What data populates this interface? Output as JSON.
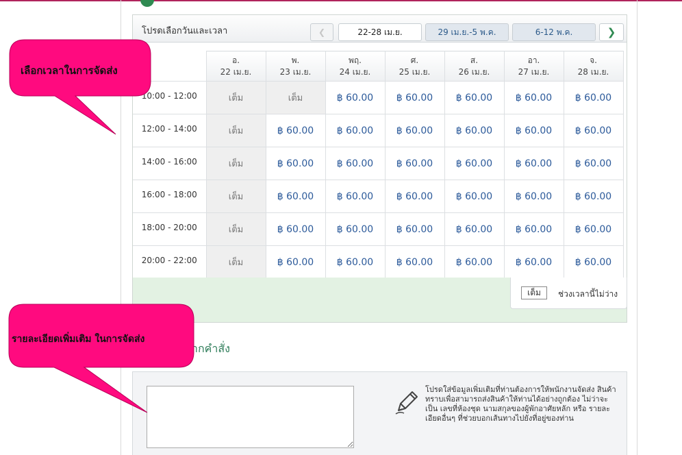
{
  "schedule": {
    "title": "โปรดเลือกวันและเวลา",
    "nav": {
      "prev_icon": "chevron-left-icon",
      "prev_glyph": "❮",
      "current_week": "22-28 เม.ย.",
      "week2": "29 เม.ย.-5 พ.ค.",
      "week3": "6-12 พ.ค.",
      "next_icon": "chevron-right-icon",
      "next_glyph": "❯"
    },
    "days": [
      {
        "day": "อ.",
        "date": "22 เม.ย."
      },
      {
        "day": "พ.",
        "date": "23 เม.ย."
      },
      {
        "day": "พฤ.",
        "date": "24 เม.ย."
      },
      {
        "day": "ศ.",
        "date": "25 เม.ย."
      },
      {
        "day": "ส.",
        "date": "26 เม.ย."
      },
      {
        "day": "อา.",
        "date": "27 เม.ย."
      },
      {
        "day": "จ.",
        "date": "28 เม.ย."
      }
    ],
    "rows": [
      {
        "time": "10:00 - 12:00",
        "cells": [
          "เต็ม",
          "เต็ม",
          "฿ 60.00",
          "฿ 60.00",
          "฿ 60.00",
          "฿ 60.00",
          "฿ 60.00"
        ]
      },
      {
        "time": "12:00 - 14:00",
        "cells": [
          "เต็ม",
          "฿ 60.00",
          "฿ 60.00",
          "฿ 60.00",
          "฿ 60.00",
          "฿ 60.00",
          "฿ 60.00"
        ]
      },
      {
        "time": "14:00 - 16:00",
        "cells": [
          "เต็ม",
          "฿ 60.00",
          "฿ 60.00",
          "฿ 60.00",
          "฿ 60.00",
          "฿ 60.00",
          "฿ 60.00"
        ]
      },
      {
        "time": "16:00 - 18:00",
        "cells": [
          "เต็ม",
          "฿ 60.00",
          "฿ 60.00",
          "฿ 60.00",
          "฿ 60.00",
          "฿ 60.00",
          "฿ 60.00"
        ]
      },
      {
        "time": "18:00 - 20:00",
        "cells": [
          "เต็ม",
          "฿ 60.00",
          "฿ 60.00",
          "฿ 60.00",
          "฿ 60.00",
          "฿ 60.00",
          "฿ 60.00"
        ]
      },
      {
        "time": "20:00 - 22:00",
        "cells": [
          "เต็ม",
          "฿ 60.00",
          "฿ 60.00",
          "฿ 60.00",
          "฿ 60.00",
          "฿ 60.00",
          "฿ 60.00"
        ]
      }
    ],
    "full_label": "เต็ม",
    "legend": {
      "swatch": "เต็ม",
      "text": "ช่วงเวลานี้ไม่ว่าง"
    }
  },
  "notes": {
    "section_title_partial": "ากคำสั่ง",
    "input_value": "",
    "hint": "โปรดใส่ข้อมูลเพิ่มเติมที่ท่านต้องการให้พนักงานจัดส่ง สินค้าทราบเพื่อสามารถส่งสินค้าให้ท่านได้อย่างถูกต้อง ไม่ว่าจะเป็น เลขที่ห้องชุด นามสกุลของผู้พักอาศัยหลัก หรือ รายละเอียดอื่นๆ ที่ช่วยบอกเส้นทางไปยังที่อยู่ของท่าน",
    "icon": "pencil-icon"
  },
  "callouts": {
    "time_select": "เลือกเวลาในการจัดส่ง",
    "extra_details": "รายละเอียดเพิ่มเติม ในการจัดส่ง"
  },
  "colors": {
    "accent_green": "#2f8a52",
    "callout_pink": "#ff0a7f",
    "price_blue": "#2c5a9a",
    "legend_bg": "#e3f2e3"
  }
}
